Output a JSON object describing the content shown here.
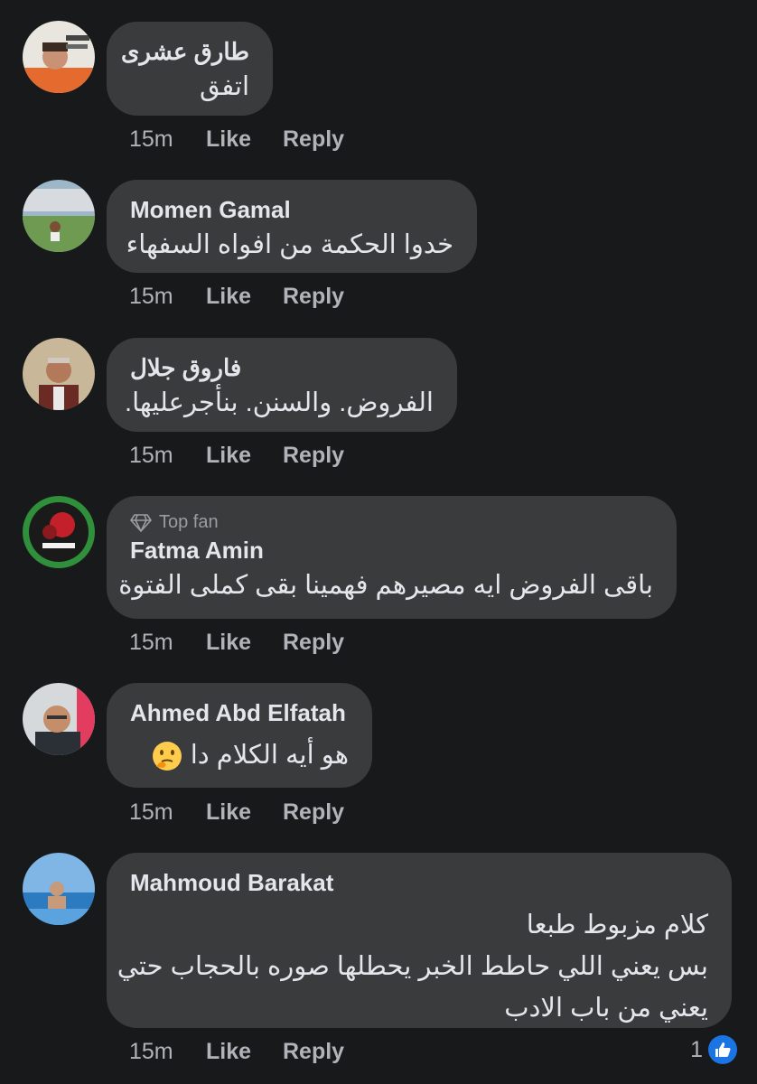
{
  "comments": [
    {
      "name": "طارق عشرى",
      "lines": [
        "اتفق"
      ],
      "time": "15m",
      "like_label": "Like",
      "reply_label": "Reply"
    },
    {
      "name": "Momen Gamal",
      "lines": [
        "خدوا الحكمة من افواه السفهاء"
      ],
      "time": "15m",
      "like_label": "Like",
      "reply_label": "Reply"
    },
    {
      "name": "فاروق جلال",
      "lines": [
        "الفروض. والسنن. بنأجرعليها."
      ],
      "time": "15m",
      "like_label": "Like",
      "reply_label": "Reply"
    },
    {
      "badge": "Top fan",
      "name": "Fatma Amin",
      "lines": [
        "باقى الفروض ايه مصيرهم فهمينا بقى كملى الفتوة"
      ],
      "time": "15m",
      "like_label": "Like",
      "reply_label": "Reply"
    },
    {
      "name": "Ahmed Abd Elfatah",
      "lines": [
        "هو أيه الكلام دا"
      ],
      "emoji": "thinking-face-emoji",
      "time": "15m",
      "like_label": "Like",
      "reply_label": "Reply"
    },
    {
      "name": "Mahmoud Barakat",
      "lines": [
        "كلام مزبوط طبعا",
        "بس يعني اللي حاطط الخبر يحطلها صوره بالحجاب حتي",
        "يعني من باب الادب"
      ],
      "time": "15m",
      "like_label": "Like",
      "reply_label": "Reply",
      "reaction_count": "1"
    }
  ],
  "colors": {
    "background": "#18191a",
    "bubble": "#3a3b3c",
    "text": "#e4e6eb",
    "secondary_text": "#b0b3b8",
    "like_blue": "#1b74e4"
  },
  "icons": {
    "top_fan": "diamond-icon",
    "reaction": "thumbs-up-icon"
  }
}
